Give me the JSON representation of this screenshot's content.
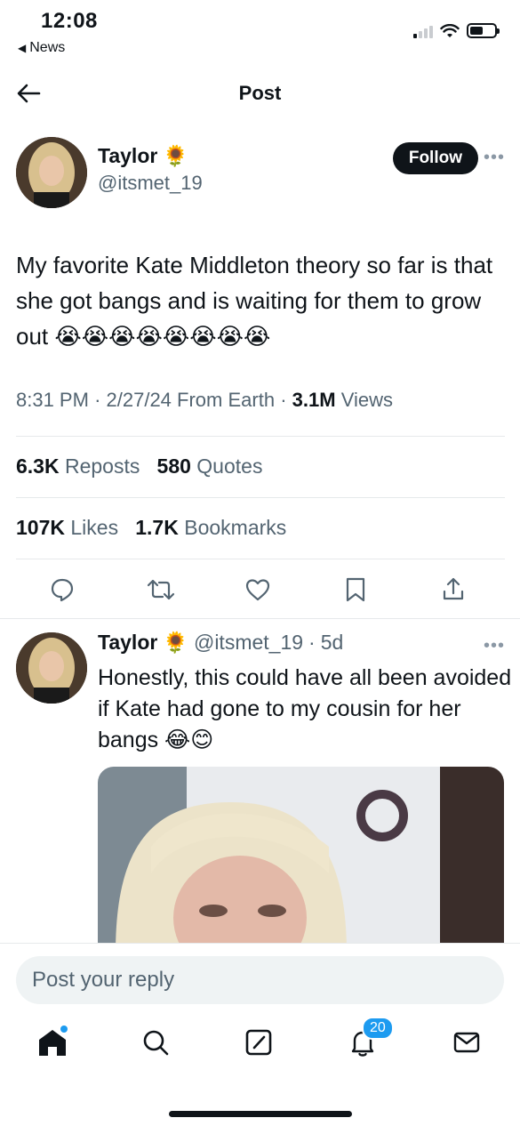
{
  "status_bar": {
    "time": "12:08",
    "back_app": "News"
  },
  "header": {
    "title": "Post"
  },
  "post": {
    "author_name": "Taylor",
    "author_emoji": "🌻",
    "author_handle": "@itsmet_19",
    "follow_label": "Follow",
    "text": "My favorite Kate Middleton theory so far is that she got bangs and is waiting for them to grow out",
    "emojis": "😭😭😭😭😭😭😭😭",
    "time": "8:31 PM",
    "date": "2/27/24",
    "source": "From Earth",
    "views_count": "3.1M",
    "views_label": "Views",
    "reposts_count": "6.3K",
    "reposts_label": "Reposts",
    "quotes_count": "580",
    "quotes_label": "Quotes",
    "likes_count": "107K",
    "likes_label": "Likes",
    "bookmarks_count": "1.7K",
    "bookmarks_label": "Bookmarks"
  },
  "reply": {
    "author_name": "Taylor",
    "author_emoji": "🌻",
    "author_handle": "@itsmet_19",
    "age": "5d",
    "text": "Honestly, this could have all been avoided if Kate had gone to my cousin for her bangs 😂😊"
  },
  "composer": {
    "placeholder": "Post your reply"
  },
  "tabbar": {
    "notifications_badge": "20"
  },
  "colors": {
    "accent": "#1d9bf0",
    "text_primary": "#0f1419",
    "text_secondary": "#536471"
  },
  "icons": {
    "actions": [
      "reply-icon",
      "repost-icon",
      "like-icon",
      "bookmark-icon",
      "share-icon"
    ],
    "tabs": [
      "home-icon",
      "search-icon",
      "compose-icon",
      "notifications-icon",
      "messages-icon"
    ]
  }
}
